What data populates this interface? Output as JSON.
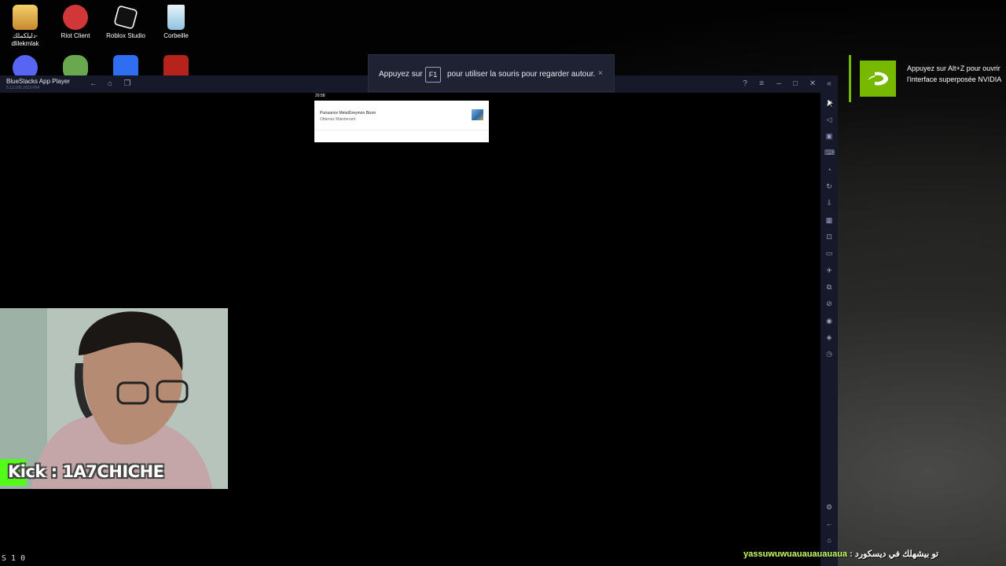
{
  "desktop": {
    "icons": [
      {
        "label": "دليلكملك-\ndlilekmlak",
        "icon": "folder-app-icon"
      },
      {
        "label": "Riot Client",
        "icon": "riot-icon"
      },
      {
        "label": "Roblox Studio",
        "icon": "roblox-studio-icon"
      },
      {
        "label": "Corbeille",
        "icon": "recycle-bin-icon"
      }
    ],
    "second_row_icons": [
      "discord-icon",
      "green-character-icon",
      "roblox-icon",
      "red-game-icon"
    ]
  },
  "bluestacks": {
    "title": "BlueStacks App Player",
    "version": "5.12.100.1023 P64",
    "toolbar_icons": [
      "back-icon",
      "home-icon",
      "recent-apps-icon"
    ],
    "window_controls": [
      "help-icon",
      "menu-icon",
      "minimize-icon",
      "maximize-icon",
      "close-icon",
      "collapse-sidebar-icon"
    ],
    "sidebar_icons": [
      "fullscreen-icon",
      "volume-icon",
      "media-icon",
      "keyboard-controls-icon",
      "macro-icon",
      "sync-icon",
      "install-apk-icon",
      "game-controls-icon",
      "screenshot-icon",
      "folder-icon",
      "airplane-mode-icon",
      "multi-instance-icon",
      "eco-mode-icon",
      "location-icon",
      "layers-icon",
      "clock-icon"
    ],
    "sidebar_bottom_icons": [
      "settings-icon",
      "back-icon",
      "home-icon"
    ]
  },
  "notification": {
    "time": "20:58",
    "title": "Puissance MetalGreymon Bizon",
    "subtitle": "Obtenez Maintenant"
  },
  "toast": {
    "prefix": "Appuyez sur",
    "key": "F1",
    "suffix": "pour utiliser la souris pour regarder autour.",
    "close": "×"
  },
  "nvidia": {
    "message": "Appuyez sur Alt+Z pour ouvrir l'interface superposée NVIDIA"
  },
  "stream": {
    "kick_label": "Kick : 1A7CHICHE",
    "bottom_left": "S   1 0",
    "ticker_latin": "yassuwuwuauauauauaua",
    "ticker_arabic": ": تو بيشهلك في ديسكورد"
  },
  "colors": {
    "bluestacks_chrome": "#16192a",
    "nvidia_green": "#76b900",
    "kick_green": "#53fc18"
  }
}
